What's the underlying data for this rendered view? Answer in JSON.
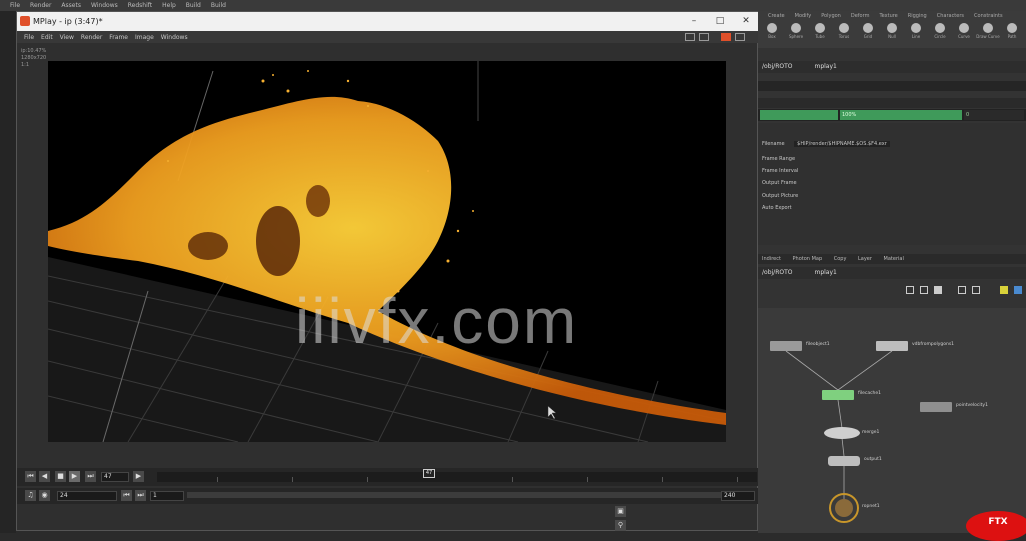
{
  "host_menu": {
    "items": [
      "File",
      "Render",
      "Assets",
      "Windows",
      "Redshift",
      "Help",
      "Build",
      "Build"
    ]
  },
  "mplay": {
    "title": "MPlay - ip (3:47)*",
    "menu": [
      "File",
      "Edit",
      "View",
      "Render",
      "Frame",
      "Image",
      "Windows"
    ],
    "info": {
      "camera": "ip:10.47%",
      "res": "1280x720",
      "ratio": "1:1"
    }
  },
  "timeline": {
    "current_frame": "47",
    "fps": "24",
    "range_start": "1",
    "range_end": "240",
    "cursor_label": "47",
    "step": "1"
  },
  "shelf": {
    "tabs": [
      "Create",
      "Modify",
      "Polygon",
      "Deform",
      "Texture",
      "Rigging",
      "Characters",
      "Constraints"
    ],
    "tools": [
      "Box",
      "Sphere",
      "Tube",
      "Torus",
      "Grid",
      "Null",
      "Line",
      "Circle",
      "Curve",
      "Draw Curve",
      "Path",
      "Spray Paint"
    ]
  },
  "parm_pane": {
    "path_label": "/obj/ROTO",
    "node_label": "mplay1",
    "progress_label": "100%",
    "progress_value": 0.78,
    "progress_right": "0",
    "filename_label": "Filename",
    "filename_value": "$HIP/render/$HIPNAME.$OS.$F4.exr",
    "rows": [
      "Frame Range",
      "Frame Interval",
      "Output Frame",
      "Output Picture",
      "Auto Export"
    ]
  },
  "network": {
    "path_label": "/obj/ROTO",
    "node_label": "mplay1",
    "bar_items": [
      "Indirect",
      "Photon Map",
      "Copy",
      "Layer",
      "Material"
    ],
    "nodes": [
      {
        "label": "fileobject1"
      },
      {
        "label": "vdbfrompolygons1"
      },
      {
        "label": "filecache1"
      },
      {
        "label": "pointvelocity1"
      },
      {
        "label": "merge1"
      },
      {
        "label": "output1"
      },
      {
        "label": "ropnet1"
      }
    ]
  },
  "watermark": "iiivfx.com",
  "logo": "FTX",
  "colors": {
    "accent": "#e0502a",
    "progress": "#3f9a5a",
    "particles": "#f0a020",
    "node_selected": "#7fd07f"
  }
}
